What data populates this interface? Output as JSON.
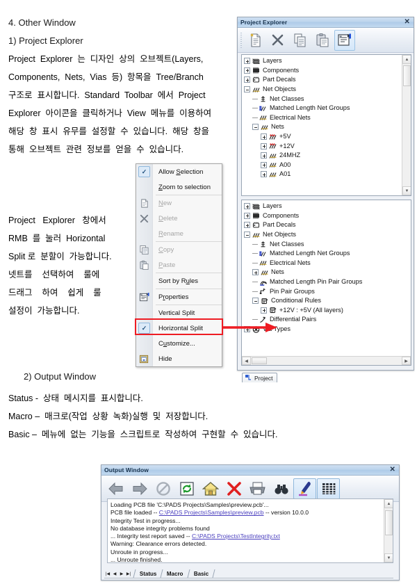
{
  "document": {
    "heading": "4. Other Window",
    "sub1": "1) Project Explorer",
    "para1_lines": [
      "Project  Explorer  는  디자인  상의  오브젝트(Layers,",
      "Components,  Nets,  Vias  등)  항목을  Tree/Branch",
      "구조로  표시합니다.  Standard  Toolbar  에서  Project",
      "Explorer  아이콘을  클릭하거나  View  메뉴를  이용하여",
      "해당  창  표시  유무를  설정할  수  있습니다.  해당  창을",
      "통해  오브젝트  관련  정보를  얻을  수  있습니다."
    ],
    "para2_lines": [
      "Project   Explorer   창에서",
      "RMB  를  눌러  Horizontal",
      "Split 로  분할이  가능합니다.",
      "넷트를    선택하여    룰에",
      "드래그    하여    쉽게    룰",
      "설정이  가능합니다."
    ],
    "sub2": "2)   Output Window",
    "para3_lines": [
      "Status -  상태  메시지를  표시합니다.",
      "Macro –  매크로(작업  상황  녹화)실행  및  저장합니다.",
      "Basic –  메뉴에  없는  기능을  스크립트로  작성하여  구현할  수  있습니다."
    ]
  },
  "project_explorer": {
    "title": "Project Explorer",
    "close_label": "✕",
    "toolbar": [
      {
        "name": "new-icon",
        "tip": "New"
      },
      {
        "name": "delete-icon",
        "tip": "Delete"
      },
      {
        "name": "copy-icon",
        "tip": "Copy"
      },
      {
        "name": "paste-icon",
        "tip": "Paste"
      },
      {
        "name": "properties-icon",
        "tip": "Properties"
      }
    ],
    "top_tree": [
      {
        "label": "Layers",
        "indent": 0,
        "exp": "plus",
        "icon": "layers-icon"
      },
      {
        "label": "Components",
        "indent": 0,
        "exp": "plus",
        "icon": "components-icon"
      },
      {
        "label": "Part Decals",
        "indent": 0,
        "exp": "plus",
        "icon": "part-decals-icon"
      },
      {
        "label": "Net Objects",
        "indent": 0,
        "exp": "minus",
        "icon": "net-objects-icon"
      },
      {
        "label": "Net Classes",
        "indent": 1,
        "exp": "none",
        "icon": "net-classes-icon"
      },
      {
        "label": "Matched Length Net Groups",
        "indent": 1,
        "exp": "none",
        "icon": "matched-length-net-groups-icon"
      },
      {
        "label": "Electrical Nets",
        "indent": 1,
        "exp": "none",
        "icon": "electrical-nets-icon"
      },
      {
        "label": "Nets",
        "indent": 1,
        "exp": "minus",
        "icon": "nets-icon"
      },
      {
        "label": "+5V",
        "indent": 2,
        "exp": "plus",
        "icon": "net-power-icon"
      },
      {
        "label": "+12V",
        "indent": 2,
        "exp": "plus",
        "icon": "net-power-icon"
      },
      {
        "label": "24MHZ",
        "indent": 2,
        "exp": "plus",
        "icon": "net-icon"
      },
      {
        "label": "A00",
        "indent": 2,
        "exp": "plus",
        "icon": "net-icon"
      },
      {
        "label": "A01",
        "indent": 2,
        "exp": "plus",
        "icon": "net-icon"
      }
    ],
    "bottom_tree": [
      {
        "label": "Layers",
        "indent": 0,
        "exp": "plus",
        "icon": "layers-icon"
      },
      {
        "label": "Components",
        "indent": 0,
        "exp": "plus",
        "icon": "components-icon"
      },
      {
        "label": "Part Decals",
        "indent": 0,
        "exp": "plus",
        "icon": "part-decals-icon"
      },
      {
        "label": "Net Objects",
        "indent": 0,
        "exp": "minus",
        "icon": "net-objects-icon"
      },
      {
        "label": "Net Classes",
        "indent": 1,
        "exp": "none",
        "icon": "net-classes-icon"
      },
      {
        "label": "Matched Length Net Groups",
        "indent": 1,
        "exp": "none",
        "icon": "matched-length-net-groups-icon"
      },
      {
        "label": "Electrical Nets",
        "indent": 1,
        "exp": "none",
        "icon": "electrical-nets-icon"
      },
      {
        "label": "Nets",
        "indent": 1,
        "exp": "plus",
        "icon": "nets-icon"
      },
      {
        "label": "Matched Length Pin Pair Groups",
        "indent": 1,
        "exp": "none",
        "icon": "matched-length-pin-pair-icon"
      },
      {
        "label": "Pin Pair Groups",
        "indent": 1,
        "exp": "none",
        "icon": "pin-pair-groups-icon"
      },
      {
        "label": "Conditional Rules",
        "indent": 1,
        "exp": "minus",
        "icon": "conditional-rules-icon"
      },
      {
        "label": "+12V : +5V (All layers)",
        "indent": 2,
        "exp": "plus",
        "icon": "conditional-rule-item-icon"
      },
      {
        "label": "Differential Pairs",
        "indent": 1,
        "exp": "none",
        "icon": "differential-pairs-icon"
      },
      {
        "label": "Via Types",
        "indent": 0,
        "exp": "plus",
        "icon": "via-types-icon"
      }
    ],
    "tab": "Project"
  },
  "context_menu": {
    "items": [
      {
        "label": "Allow Selection",
        "acc": "S",
        "checked": true,
        "disabled": false,
        "icon": null,
        "sep_after": false
      },
      {
        "label": "Zoom to selection",
        "acc": "Z",
        "checked": false,
        "disabled": false,
        "icon": null,
        "sep_after": true
      },
      {
        "label": "New",
        "acc": "N",
        "checked": false,
        "disabled": true,
        "icon": "new-icon",
        "sep_after": false
      },
      {
        "label": "Delete",
        "acc": "D",
        "checked": false,
        "disabled": true,
        "icon": "delete-icon",
        "sep_after": false
      },
      {
        "label": "Rename",
        "acc": "R",
        "checked": false,
        "disabled": true,
        "icon": null,
        "sep_after": true
      },
      {
        "label": "Copy",
        "acc": "C",
        "checked": false,
        "disabled": true,
        "icon": "copy-icon",
        "sep_after": false
      },
      {
        "label": "Paste",
        "acc": "P",
        "checked": false,
        "disabled": true,
        "icon": "paste-icon",
        "sep_after": true
      },
      {
        "label": "Sort by Rules",
        "acc": "u",
        "checked": false,
        "disabled": false,
        "icon": null,
        "sep_after": true
      },
      {
        "label": "Properties",
        "acc": "r",
        "checked": false,
        "disabled": false,
        "icon": "properties-icon",
        "sep_after": true
      },
      {
        "label": "Vertical Split",
        "acc": "",
        "checked": false,
        "disabled": false,
        "icon": null,
        "sep_after": false
      },
      {
        "label": "Horizontal Split",
        "acc": "",
        "checked": true,
        "disabled": false,
        "icon": null,
        "sep_after": false,
        "highlight": true
      },
      {
        "label": "Customize...",
        "acc": "u",
        "checked": false,
        "disabled": false,
        "icon": null,
        "sep_after": false
      },
      {
        "label": "Hide",
        "acc": "",
        "checked": false,
        "disabled": false,
        "icon": "hide-icon",
        "sep_after": false
      }
    ],
    "highlight_color": "#ee1c23"
  },
  "output_window": {
    "title": "Output Window",
    "close_label": "✕",
    "toolbar": [
      {
        "name": "back-arrow-icon",
        "active": false
      },
      {
        "name": "forward-arrow-icon",
        "active": false
      },
      {
        "name": "stop-icon",
        "active": false
      },
      {
        "name": "refresh-icon",
        "active": false
      },
      {
        "name": "home-icon",
        "active": false
      },
      {
        "name": "delete-x-icon",
        "active": false
      },
      {
        "name": "print-icon",
        "active": false
      },
      {
        "name": "find-binoculars-icon",
        "active": false
      },
      {
        "name": "highlight-pen-icon",
        "active": true
      },
      {
        "name": "grid-icon",
        "active": true
      }
    ],
    "log": [
      {
        "pre": "Loading PCB file 'C:\\PADS Projects\\Samples\\preview.pcb'...",
        "link": "",
        "post": ""
      },
      {
        "pre": "PCB file loaded -- ",
        "link": "C:\\PADS Projects\\Samples\\preview.pcb",
        "post": " -- version 10.0.0"
      },
      {
        "pre": "Integrity Test in progress...",
        "link": "",
        "post": ""
      },
      {
        "pre": "No database integrity problems found",
        "link": "",
        "post": ""
      },
      {
        "pre": "... Integrity test report saved -- ",
        "link": "C:\\PADS Projects\\TestIntegrity.txt",
        "post": ""
      },
      {
        "pre": "Warning: Clearance errors detected.",
        "link": "",
        "post": ""
      },
      {
        "pre": "Unroute in progress...",
        "link": "",
        "post": ""
      },
      {
        "pre": "... Unroute finished.",
        "link": "",
        "post": ""
      }
    ],
    "tabs": [
      "Status",
      "Macro",
      "Basic"
    ],
    "nav": [
      "|◀",
      "◀",
      "▶",
      "▶|"
    ]
  }
}
